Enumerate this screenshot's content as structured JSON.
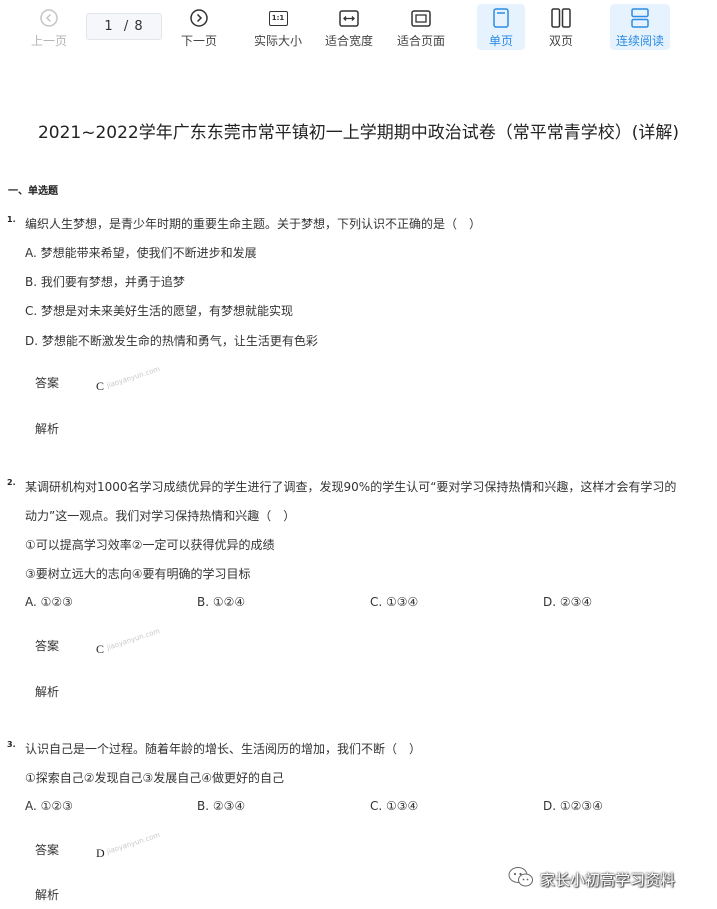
{
  "toolbar": {
    "prev_label": "上一页",
    "page_indicator": "1  / 8",
    "next_label": "下一页",
    "actual_size_label": "实际大小",
    "fit_width_label": "适合宽度",
    "fit_page_label": "适合页面",
    "single_page_label": "单页",
    "double_page_label": "双页",
    "continuous_label": "连续阅读",
    "actual_size_icon_text": "1:1",
    "active_color": "#2b8ce4"
  },
  "document": {
    "title": "2021~2022学年广东东莞市常平镇初一上学期期中政治试卷（常平常青学校）(详解)",
    "section_title": "一、单选题",
    "answer_label": "答案",
    "analysis_label": "解析",
    "watermark": "jiaoyanyun.com",
    "questions": [
      {
        "number": "1.",
        "stem": "编织人生梦想，是青少年时期的重要生命主题。关于梦想，下列认识不正确的是（　）",
        "options": [
          "A. 梦想能带来希望，使我们不断进步和发展",
          "B. 我们要有梦想，并勇于追梦",
          "C. 梦想是对未来美好生活的愿望，有梦想就能实现",
          "D. 梦想能不断激发生命的热情和勇气，让生活更有色彩"
        ],
        "answer": "C"
      },
      {
        "number": "2.",
        "stem_line1": "某调研机构对1000名学习成绩优异的学生进行了调查，发现90%的学生认可“要对学习保持热情和兴趣，这样才会有学习的",
        "stem_line2": "动力”这一观点。我们对学习保持热情和兴趣（　）",
        "statements": [
          "①可以提高学习效率②一定可以获得优异的成绩",
          "③要树立远大的志向④要有明确的学习目标"
        ],
        "options": [
          "A. ①②③",
          "B. ①②④",
          "C. ①③④",
          "D. ②③④"
        ],
        "answer": "C"
      },
      {
        "number": "3.",
        "stem": "认识自己是一个过程。随着年龄的增长、生活阅历的增加，我们不断（　）",
        "statements": [
          "①探索自己②发现自己③发展自己④做更好的自己"
        ],
        "options": [
          "A. ①②③",
          "B. ②③④",
          "C. ①③④",
          "D. ①②③④"
        ],
        "answer": "D"
      }
    ]
  },
  "brand": {
    "text": "家长小初高学习资料",
    "icon": "wechat-icon"
  }
}
